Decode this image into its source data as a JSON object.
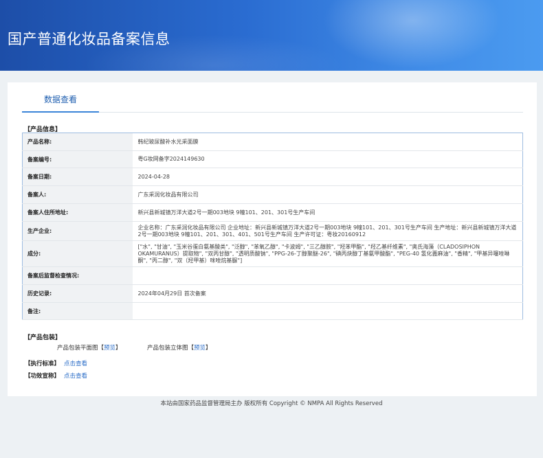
{
  "header": {
    "title": "国产普通化妆品备案信息"
  },
  "tabs": [
    {
      "label": "数据查看"
    }
  ],
  "product_info": {
    "section_title": "【产品信息】",
    "rows": [
      {
        "key": "产品名称:",
        "value": "韩纪玻尿酸补水光采面膜"
      },
      {
        "key": "备案编号:",
        "value": "粤G妆网备字2024149630"
      },
      {
        "key": "备案日期:",
        "value": "2024-04-28"
      },
      {
        "key": "备案人:",
        "value": "广东采润化妆品有限公司"
      },
      {
        "key": "备案人住所地址:",
        "value": "新兴县新城镇万洋大道2号一期003地块 9幢101、201、301号生产车间"
      },
      {
        "key": "生产企业:",
        "value": "企业名称：广东采润化妆品有限公司 企业地址：新兴县新城镇万洋大道2号一期003地块 9幢101、201、301号生产车间 生产地址：新兴县新城镇万洋大道2号一期003地块 9幢101、201、301、401、501号生产车间 生产许可证：粤妆20160912"
      },
      {
        "key": "成分:",
        "value": "[\"水\", \"甘油\", \"玉米谷蛋白氨基酸类\", \"泛醇\", \"苯氧乙醇\", \"卡波姆\", \"三乙醇胺\", \"羟苯甲酯\", \"羟乙基纤维素\", \"奥氏海藻（CLADOSIPHON OKAMURANUS）提取物\", \"双丙甘醇\", \"透明质酸钠\", \"PPG-26-丁醇聚醚-26\", \"碘丙炔醇丁基氨甲酸酯\", \"PEG-40 氢化蓖麻油\", \"香精\", \"甲基异噻唑啉酮\", \"丙二醇\", \"双（羟甲基）咪唑烷基脲\"]"
      },
      {
        "key": "备案后监督检查情况:",
        "value": ""
      },
      {
        "key": "历史记录:",
        "value": "2024年04月29日 首次备案"
      },
      {
        "key": "备注:",
        "value": ""
      }
    ]
  },
  "packaging": {
    "section_title": "【产品包装】",
    "flat_label": "产品包装平面图",
    "flat_link": "预览",
    "solid_label": "产品包装立体图",
    "solid_link": "预览"
  },
  "standard": {
    "label": "【执行标准】",
    "link": "点击查看"
  },
  "efficacy": {
    "label": "【功效宣称】",
    "link": "点击查看"
  },
  "footer": {
    "text": "本站由国家药品监督管理局主办 版权所有 Copyright © NMPA All Rights Reserved"
  }
}
